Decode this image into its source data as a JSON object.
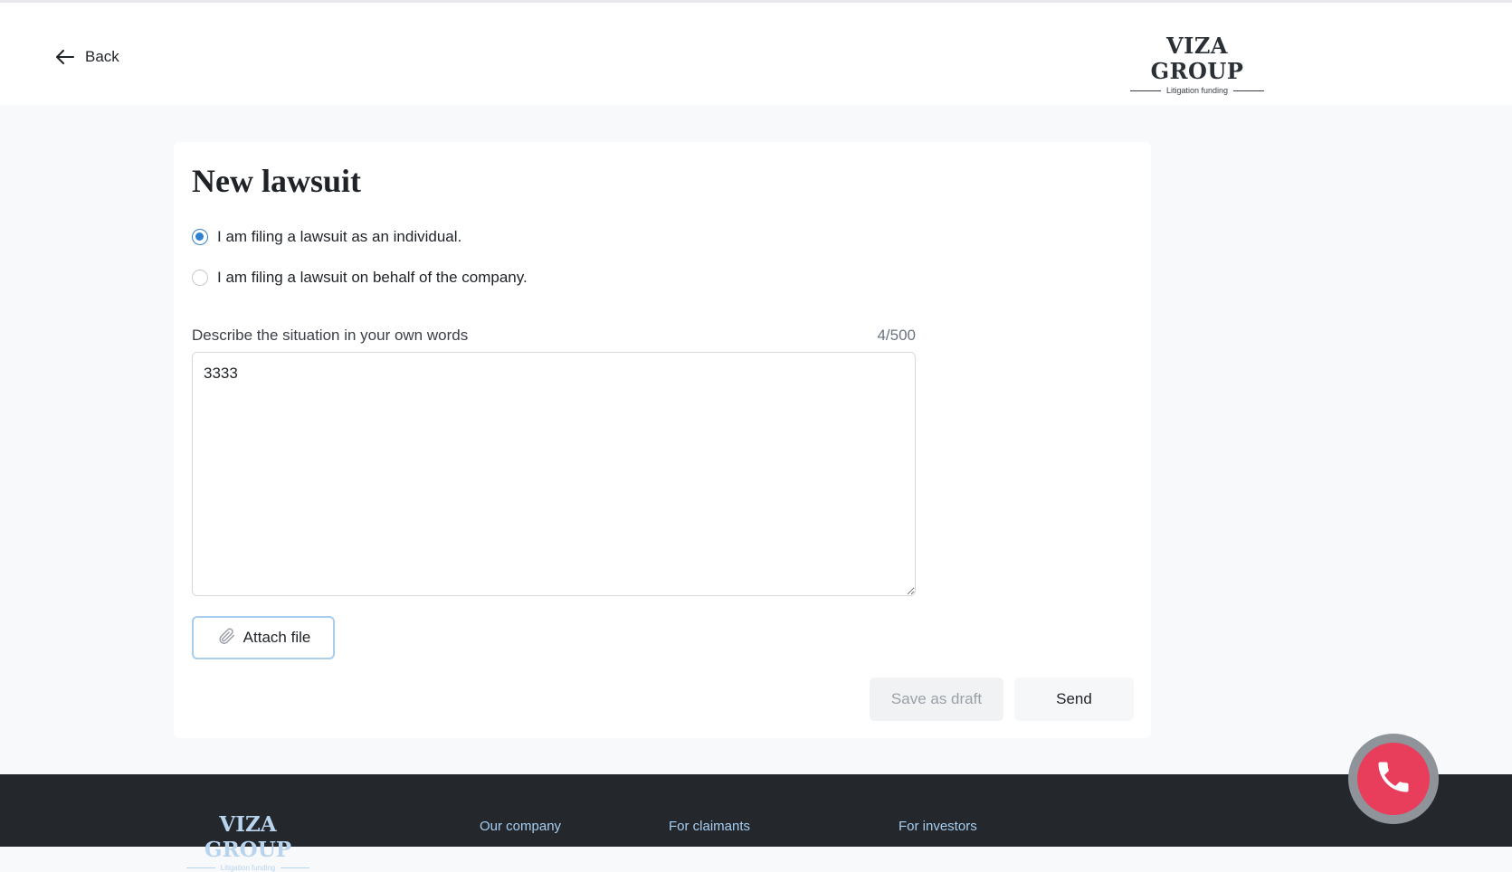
{
  "header": {
    "back_label": "Back",
    "logo": {
      "brand": "VIZA GROUP",
      "tagline": "Litigation funding"
    }
  },
  "form": {
    "title": "New lawsuit",
    "radio_options": [
      {
        "label": "I am filing a lawsuit as an individual.",
        "checked": true
      },
      {
        "label": "I am filing a lawsuit on behalf of the company.",
        "checked": false
      }
    ],
    "description_label": "Describe the situation in your own words",
    "char_counter": "4/500",
    "description_value": "3333",
    "attach_label": "Attach file",
    "save_draft_label": "Save as draft",
    "send_label": "Send"
  },
  "footer": {
    "logo": {
      "brand": "VIZA GROUP",
      "tagline": "Litigation funding"
    },
    "links": [
      "Our company",
      "For claimants",
      "For investors"
    ]
  },
  "colors": {
    "accent": "#2f80d1",
    "call_button": "#e83d5b",
    "footer_bg": "#24282d",
    "footer_link": "#a6cdf0"
  },
  "icons": {
    "back": "arrow-left-icon",
    "attach": "paperclip-icon",
    "call": "phone-icon"
  }
}
